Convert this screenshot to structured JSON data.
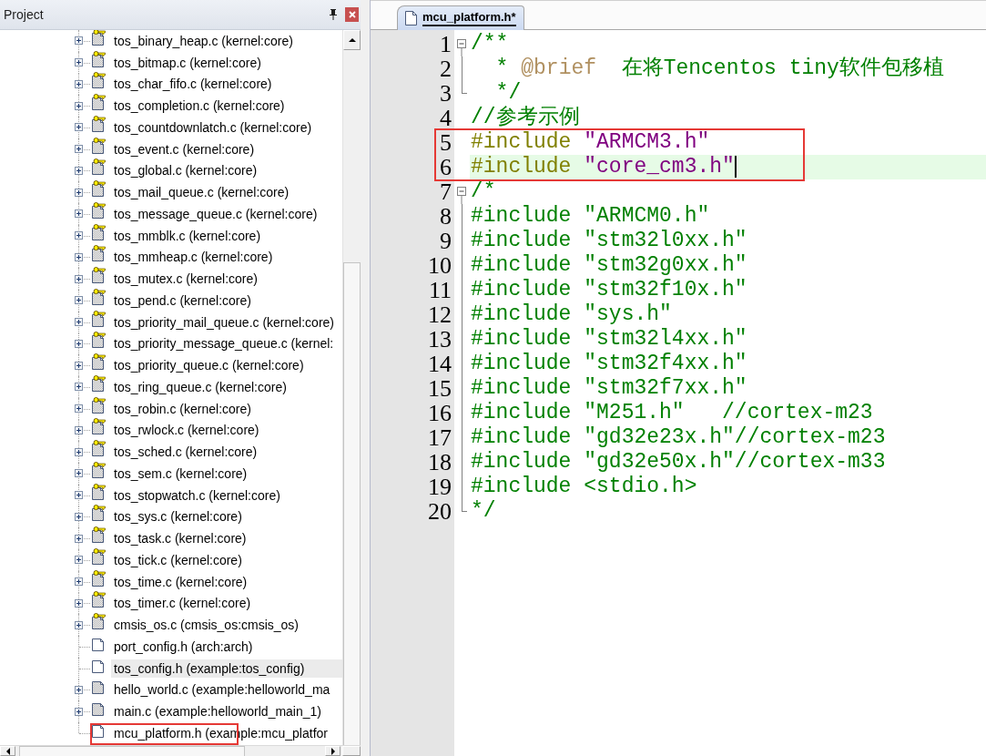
{
  "project_panel": {
    "title": "Project",
    "tree": [
      {
        "label": "tos_binary_heap.c (kernel:core)",
        "kind": "key-source",
        "expanded": false,
        "selected": false,
        "boxed": false
      },
      {
        "label": "tos_bitmap.c (kernel:core)",
        "kind": "key-source",
        "expanded": false,
        "selected": false,
        "boxed": false
      },
      {
        "label": "tos_char_fifo.c (kernel:core)",
        "kind": "key-source",
        "expanded": false,
        "selected": false,
        "boxed": false
      },
      {
        "label": "tos_completion.c (kernel:core)",
        "kind": "key-source",
        "expanded": false,
        "selected": false,
        "boxed": false
      },
      {
        "label": "tos_countdownlatch.c (kernel:core)",
        "kind": "key-source",
        "expanded": false,
        "selected": false,
        "boxed": false
      },
      {
        "label": "tos_event.c (kernel:core)",
        "kind": "key-source",
        "expanded": false,
        "selected": false,
        "boxed": false
      },
      {
        "label": "tos_global.c (kernel:core)",
        "kind": "key-source",
        "expanded": false,
        "selected": false,
        "boxed": false
      },
      {
        "label": "tos_mail_queue.c (kernel:core)",
        "kind": "key-source",
        "expanded": false,
        "selected": false,
        "boxed": false
      },
      {
        "label": "tos_message_queue.c (kernel:core)",
        "kind": "key-source",
        "expanded": false,
        "selected": false,
        "boxed": false
      },
      {
        "label": "tos_mmblk.c (kernel:core)",
        "kind": "key-source",
        "expanded": false,
        "selected": false,
        "boxed": false
      },
      {
        "label": "tos_mmheap.c (kernel:core)",
        "kind": "key-source",
        "expanded": false,
        "selected": false,
        "boxed": false
      },
      {
        "label": "tos_mutex.c (kernel:core)",
        "kind": "key-source",
        "expanded": false,
        "selected": false,
        "boxed": false
      },
      {
        "label": "tos_pend.c (kernel:core)",
        "kind": "key-source",
        "expanded": false,
        "selected": false,
        "boxed": false
      },
      {
        "label": "tos_priority_mail_queue.c (kernel:core)",
        "kind": "key-source",
        "expanded": false,
        "selected": false,
        "boxed": false
      },
      {
        "label": "tos_priority_message_queue.c (kernel:",
        "kind": "key-source",
        "expanded": false,
        "selected": false,
        "boxed": false
      },
      {
        "label": "tos_priority_queue.c (kernel:core)",
        "kind": "key-source",
        "expanded": false,
        "selected": false,
        "boxed": false
      },
      {
        "label": "tos_ring_queue.c (kernel:core)",
        "kind": "key-source",
        "expanded": false,
        "selected": false,
        "boxed": false
      },
      {
        "label": "tos_robin.c (kernel:core)",
        "kind": "key-source",
        "expanded": false,
        "selected": false,
        "boxed": false
      },
      {
        "label": "tos_rwlock.c (kernel:core)",
        "kind": "key-source",
        "expanded": false,
        "selected": false,
        "boxed": false
      },
      {
        "label": "tos_sched.c (kernel:core)",
        "kind": "key-source",
        "expanded": false,
        "selected": false,
        "boxed": false
      },
      {
        "label": "tos_sem.c (kernel:core)",
        "kind": "key-source",
        "expanded": false,
        "selected": false,
        "boxed": false
      },
      {
        "label": "tos_stopwatch.c (kernel:core)",
        "kind": "key-source",
        "expanded": false,
        "selected": false,
        "boxed": false
      },
      {
        "label": "tos_sys.c (kernel:core)",
        "kind": "key-source",
        "expanded": false,
        "selected": false,
        "boxed": false
      },
      {
        "label": "tos_task.c (kernel:core)",
        "kind": "key-source",
        "expanded": false,
        "selected": false,
        "boxed": false
      },
      {
        "label": "tos_tick.c (kernel:core)",
        "kind": "key-source",
        "expanded": false,
        "selected": false,
        "boxed": false
      },
      {
        "label": "tos_time.c (kernel:core)",
        "kind": "key-source",
        "expanded": false,
        "selected": false,
        "boxed": false
      },
      {
        "label": "tos_timer.c (kernel:core)",
        "kind": "key-source",
        "expanded": false,
        "selected": false,
        "boxed": false
      },
      {
        "label": "cmsis_os.c (cmsis_os:cmsis_os)",
        "kind": "key-source",
        "expanded": false,
        "selected": false,
        "boxed": false
      },
      {
        "label": "port_config.h (arch:arch)",
        "kind": "header",
        "selected": false,
        "boxed": false
      },
      {
        "label": "tos_config.h (example:tos_config)",
        "kind": "header",
        "selected": true,
        "boxed": false
      },
      {
        "label": "hello_world.c (example:helloworld_ma",
        "kind": "source",
        "expanded": false,
        "selected": false,
        "boxed": false
      },
      {
        "label": "main.c (example:helloworld_main_1)",
        "kind": "source",
        "expanded": false,
        "selected": false,
        "boxed": false
      },
      {
        "label": "mcu_platform.h (example:mcu_platfor",
        "kind": "header",
        "selected": false,
        "boxed": true
      }
    ]
  },
  "editor": {
    "tabs": [
      {
        "label": "mcu_platform.h*",
        "selected": true
      }
    ],
    "lines": [
      {
        "number": "1",
        "kind": "fold-start",
        "current": false,
        "boxed": false,
        "tokens": [
          {
            "kind": "comment",
            "text": "/**"
          }
        ]
      },
      {
        "number": "2",
        "kind": "fold-body",
        "current": false,
        "boxed": false,
        "tokens": [
          {
            "kind": "comment",
            "text": "  * "
          },
          {
            "kind": "tag",
            "text": "@brief"
          },
          {
            "kind": "comment",
            "text": "  在将Tencentos tiny软件包移植"
          }
        ]
      },
      {
        "number": "3",
        "kind": "fold-end",
        "current": false,
        "boxed": false,
        "tokens": [
          {
            "kind": "comment",
            "text": "  */"
          }
        ]
      },
      {
        "number": "4",
        "kind": "plain",
        "current": false,
        "boxed": false,
        "tokens": [
          {
            "kind": "comment",
            "text": "//参考示例"
          }
        ]
      },
      {
        "number": "5",
        "kind": "plain",
        "current": false,
        "boxed": true,
        "tokens": [
          {
            "kind": "directive",
            "text": "#include "
          },
          {
            "kind": "string",
            "text": "\"ARMCM3.h\""
          }
        ]
      },
      {
        "number": "6",
        "kind": "plain",
        "current": true,
        "boxed": true,
        "tokens": [
          {
            "kind": "directive",
            "text": "#include "
          },
          {
            "kind": "string",
            "text": "\"core_cm3.h\""
          }
        ]
      },
      {
        "number": "7",
        "kind": "fold-start",
        "current": false,
        "boxed": false,
        "tokens": [
          {
            "kind": "comment",
            "text": "/*"
          }
        ]
      },
      {
        "number": "8",
        "kind": "fold-body",
        "current": false,
        "boxed": false,
        "tokens": [
          {
            "kind": "comment",
            "text": "#include \"ARMCM0.h\""
          }
        ]
      },
      {
        "number": "9",
        "kind": "fold-body",
        "current": false,
        "boxed": false,
        "tokens": [
          {
            "kind": "comment",
            "text": "#include \"stm32l0xx.h\""
          }
        ]
      },
      {
        "number": "10",
        "kind": "fold-body",
        "current": false,
        "boxed": false,
        "tokens": [
          {
            "kind": "comment",
            "text": "#include \"stm32g0xx.h\""
          }
        ]
      },
      {
        "number": "11",
        "kind": "fold-body",
        "current": false,
        "boxed": false,
        "tokens": [
          {
            "kind": "comment",
            "text": "#include \"stm32f10x.h\""
          }
        ]
      },
      {
        "number": "12",
        "kind": "fold-body",
        "current": false,
        "boxed": false,
        "tokens": [
          {
            "kind": "comment",
            "text": "#include \"sys.h\""
          }
        ]
      },
      {
        "number": "13",
        "kind": "fold-body",
        "current": false,
        "boxed": false,
        "tokens": [
          {
            "kind": "comment",
            "text": "#include \"stm32l4xx.h\""
          }
        ]
      },
      {
        "number": "14",
        "kind": "fold-body",
        "current": false,
        "boxed": false,
        "tokens": [
          {
            "kind": "comment",
            "text": "#include \"stm32f4xx.h\""
          }
        ]
      },
      {
        "number": "15",
        "kind": "fold-body",
        "current": false,
        "boxed": false,
        "tokens": [
          {
            "kind": "comment",
            "text": "#include \"stm32f7xx.h\""
          }
        ]
      },
      {
        "number": "16",
        "kind": "fold-body",
        "current": false,
        "boxed": false,
        "tokens": [
          {
            "kind": "comment",
            "text": "#include \"M251.h\"   //cortex-m23"
          }
        ]
      },
      {
        "number": "17",
        "kind": "fold-body",
        "current": false,
        "boxed": false,
        "tokens": [
          {
            "kind": "comment",
            "text": "#include \"gd32e23x.h\"//cortex-m23"
          }
        ]
      },
      {
        "number": "18",
        "kind": "fold-body",
        "current": false,
        "boxed": false,
        "tokens": [
          {
            "kind": "comment",
            "text": "#include \"gd32e50x.h\"//cortex-m33"
          }
        ]
      },
      {
        "number": "19",
        "kind": "fold-body",
        "current": false,
        "boxed": false,
        "tokens": [
          {
            "kind": "comment",
            "text": "#include <stdio.h>"
          }
        ]
      },
      {
        "number": "20",
        "kind": "fold-end",
        "current": false,
        "boxed": false,
        "tokens": [
          {
            "kind": "comment",
            "text": "*/"
          }
        ]
      }
    ]
  }
}
